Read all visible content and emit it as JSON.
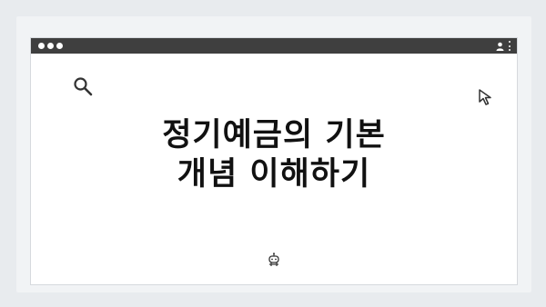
{
  "headline": {
    "line1": "정기예금의 기본",
    "line2": "개념 이해하기"
  },
  "icons": {
    "search": "search-icon",
    "cursor": "cursor-icon",
    "robot": "robot-icon",
    "user": "user-icon",
    "menu": "kebab-menu-icon"
  },
  "colors": {
    "titlebar": "#3f3f3f",
    "background": "#e8ebee",
    "window": "#ffffff",
    "text": "#111111"
  }
}
